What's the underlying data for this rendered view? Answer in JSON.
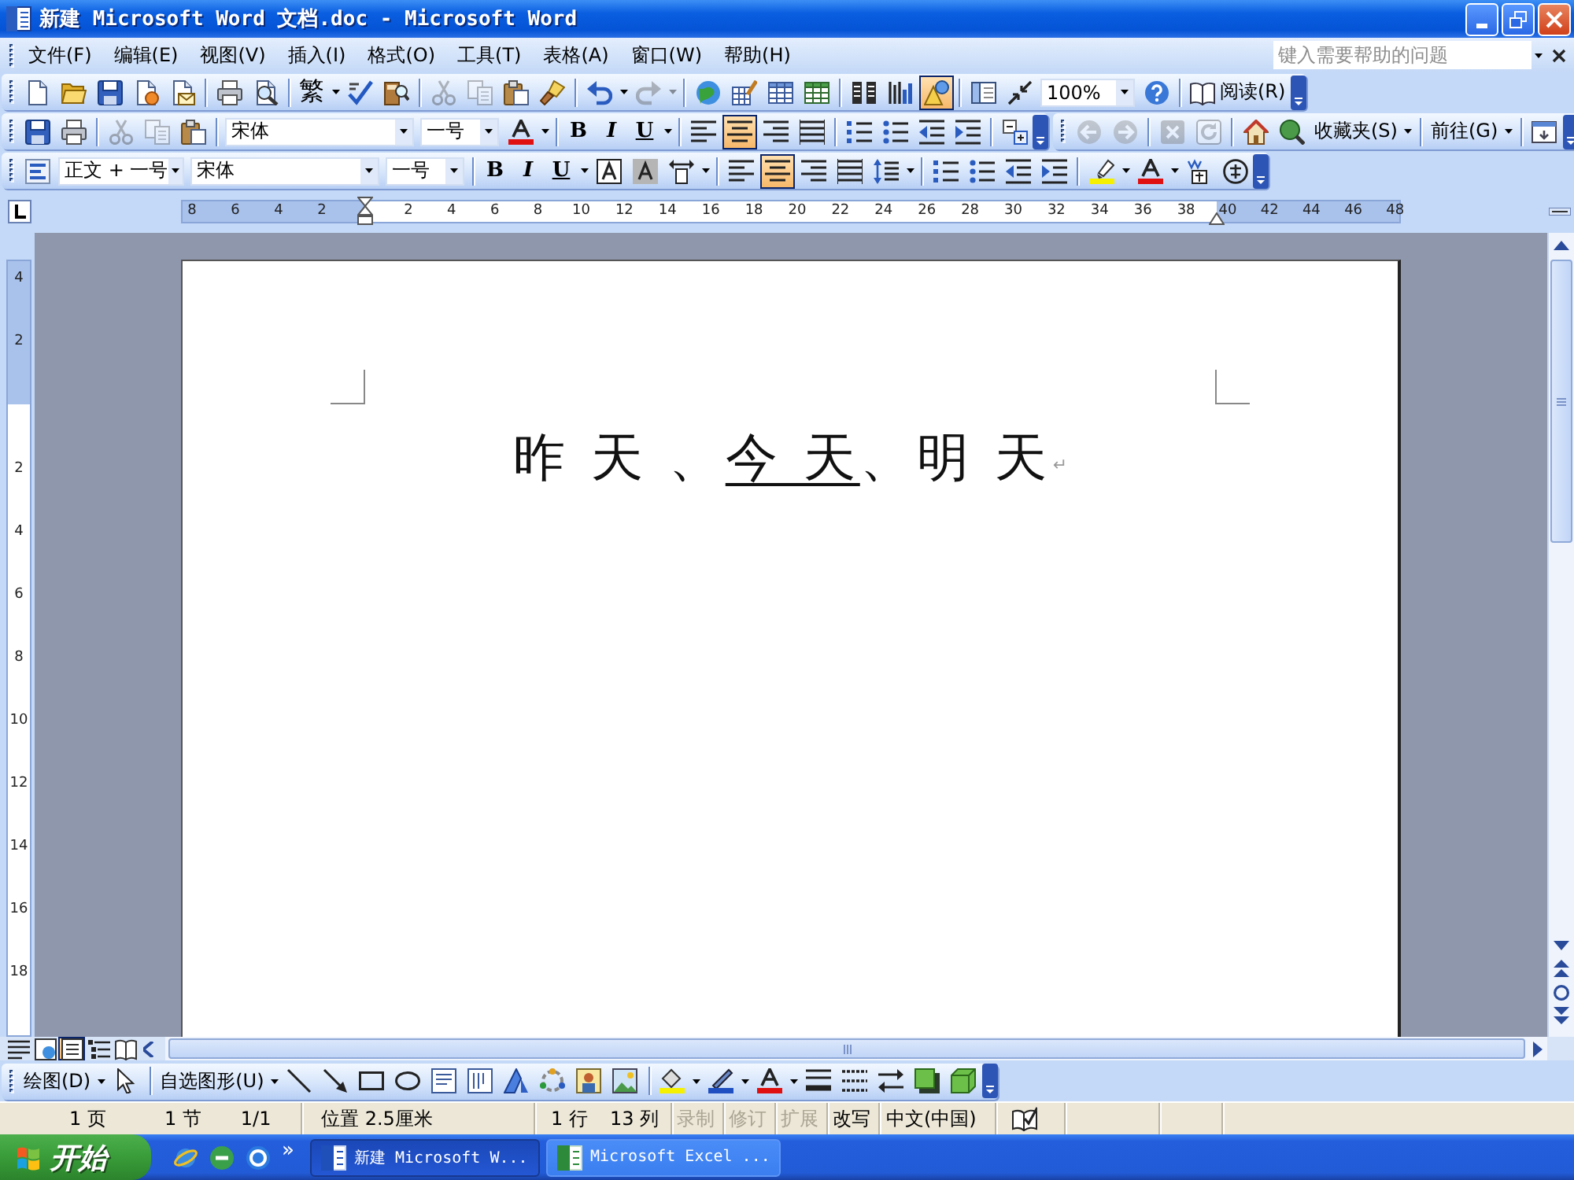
{
  "window": {
    "title": "新建 Microsoft Word 文档.doc - Microsoft Word"
  },
  "menu_bar": {
    "items": [
      "文件(F)",
      "编辑(E)",
      "视图(V)",
      "插入(I)",
      "格式(O)",
      "工具(T)",
      "表格(A)",
      "窗口(W)",
      "帮助(H)"
    ],
    "help_box": {
      "placeholder": "键入需要帮助的问题"
    }
  },
  "standard_toolbar": {
    "traditional_chinese_button": "繁",
    "edit_buttons": [
      {
        "disabled": true
      },
      {
        "disabled": true
      },
      {
        "disabled": false
      }
    ],
    "history_buttons": [
      {
        "disabled": false
      },
      {
        "disabled": true
      }
    ],
    "toggles": [
      {
        "pressed": true
      },
      {
        "pressed": false
      },
      {
        "pressed": false
      }
    ],
    "zoom": "100%",
    "read_button": "阅读(R)"
  },
  "formatting_toolbar": {
    "edit_buttons": [
      {
        "disabled": true
      },
      {
        "disabled": true
      },
      {
        "disabled": false
      }
    ],
    "font": "宋体",
    "font_size": "一号",
    "char_buttons": [
      {
        "label": "B",
        "pressed": false
      },
      {
        "label": "I",
        "pressed": false
      },
      {
        "label": "U",
        "pressed": false
      }
    ],
    "alignment": [
      {
        "selected": false
      },
      {
        "selected": true
      },
      {
        "selected": false
      },
      {
        "selected": false
      }
    ]
  },
  "web_toolbar": {
    "navigation_buttons": [
      {
        "disabled": true
      },
      {
        "disabled": true
      },
      {
        "disabled": true
      },
      {
        "disabled": true
      }
    ],
    "favorites_menu": "收藏夹(S)",
    "go_menu": "前往(G)"
  },
  "formatting_toolbar_2": {
    "style": "正文 + 一号",
    "font": "宋体",
    "font_size": "一号",
    "char_buttons": [
      {
        "label": "B",
        "pressed": false
      },
      {
        "label": "I",
        "pressed": false
      },
      {
        "label": "U",
        "pressed": false
      }
    ],
    "alignment": [
      {
        "selected": false
      },
      {
        "selected": true
      },
      {
        "selected": false
      },
      {
        "selected": false
      }
    ]
  },
  "horizontal_ruler": {
    "left_margin_labels": [
      "8",
      "6",
      "4",
      "2"
    ],
    "text_labels": [
      "2",
      "4",
      "6",
      "8",
      "10",
      "12",
      "14",
      "16",
      "18",
      "20",
      "22",
      "24",
      "26",
      "28",
      "30",
      "32",
      "34",
      "36",
      "38"
    ],
    "right_margin_labels": [
      "40",
      "42",
      "44",
      "46",
      "48"
    ]
  },
  "vertical_ruler": {
    "top_margin_labels": [
      "4",
      "2"
    ],
    "text_labels": [
      "2",
      "4",
      "6",
      "8",
      "10",
      "12",
      "14",
      "16",
      "18"
    ]
  },
  "document": {
    "paragraphs": [
      {
        "runs": [
          {
            "text": "昨 天 、",
            "underlined": false
          },
          {
            "text": "今 天",
            "underlined": true
          },
          {
            "text": "、明 天",
            "underlined": false
          }
        ],
        "mark": "↵"
      }
    ]
  },
  "view_buttons": [
    {
      "selected": false
    },
    {
      "selected": false
    },
    {
      "selected": true
    },
    {
      "selected": false
    },
    {
      "selected": false
    }
  ],
  "drawing_toolbar": {
    "draw_menu": "绘图(D)",
    "autoshapes_menu": "自选图形(U)"
  },
  "status_bar": {
    "page": "1 页",
    "section": "1 节",
    "pages": "1/1",
    "position": "位置 2.5厘米",
    "line": "1 行",
    "column": "13 列",
    "modes": [
      {
        "label": "录制",
        "on": false
      },
      {
        "label": "修订",
        "on": false
      },
      {
        "label": "扩展",
        "on": false
      },
      {
        "label": "改写",
        "on": true
      }
    ],
    "language": "中文(中国)"
  },
  "taskbar": {
    "start_button": "开始",
    "quick_launch_more": "»",
    "tasks": [
      {
        "label": "新建 Microsoft W...",
        "selected": true
      },
      {
        "label": "Microsoft Excel ...",
        "selected": false
      }
    ]
  }
}
